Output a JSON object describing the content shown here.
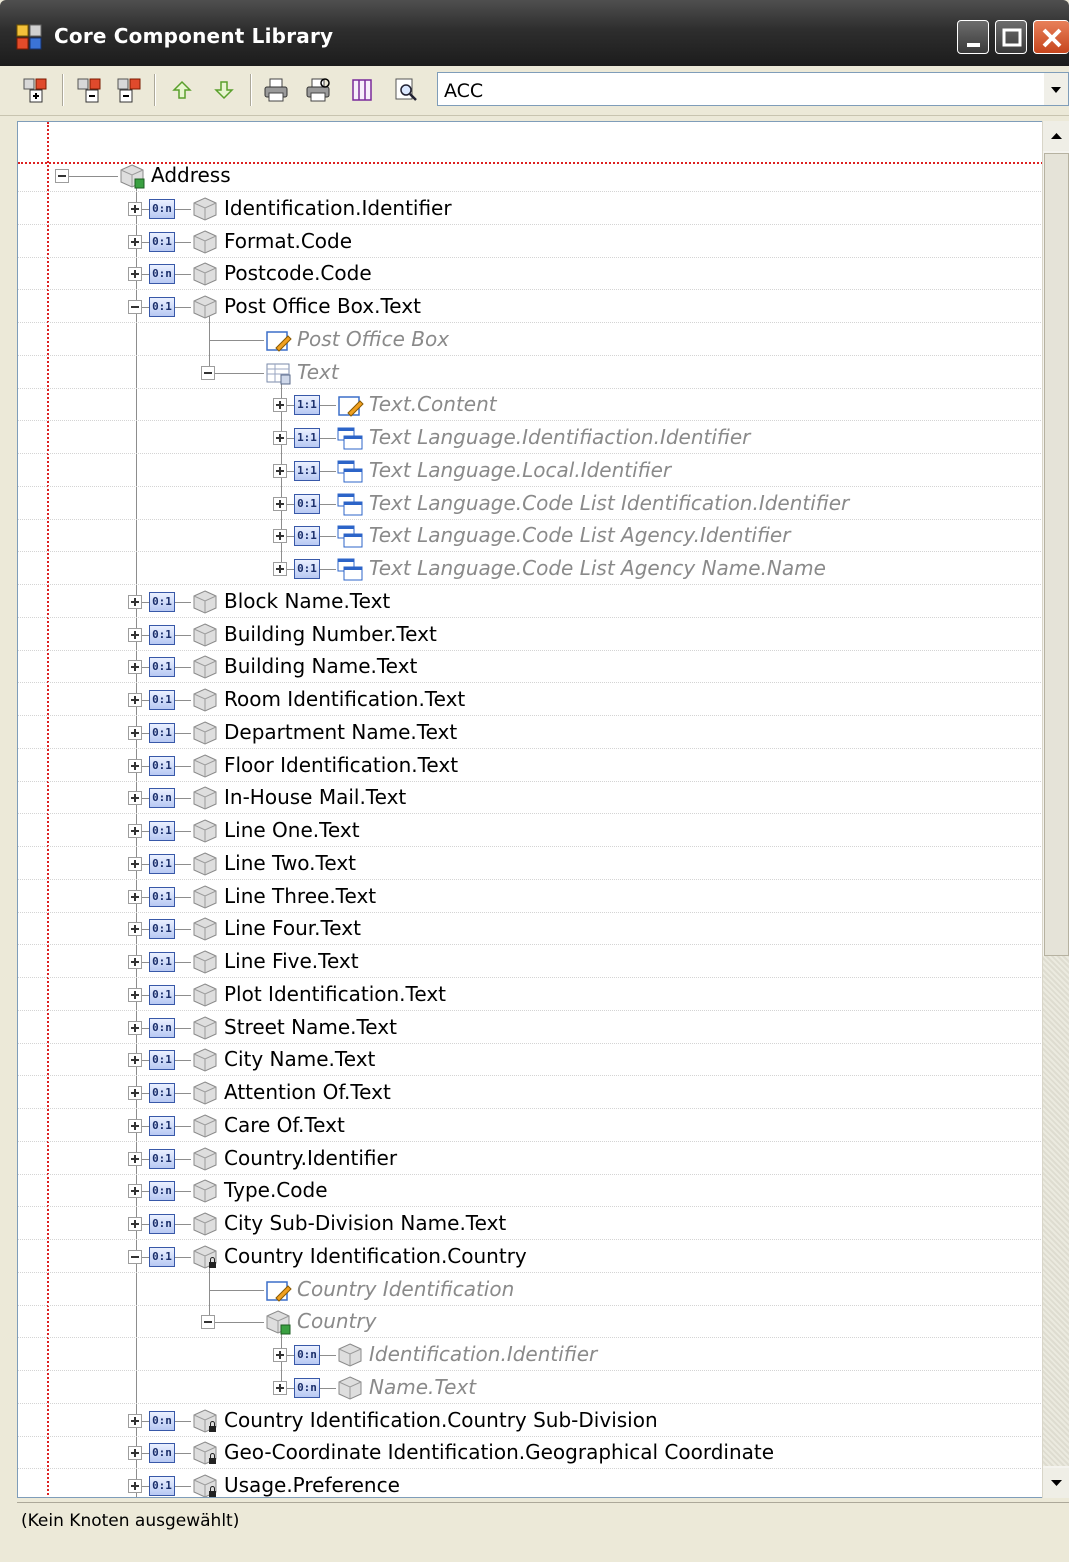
{
  "window": {
    "title": "Core Component Library"
  },
  "toolbar": {
    "combo_value": "ACC",
    "buttons": [
      "add-node-icon",
      "add-child-icon",
      "remove-node-icon",
      "move-up-icon",
      "move-down-icon",
      "print-icon",
      "print-preview-icon",
      "columns-icon",
      "zoom-icon"
    ]
  },
  "tree": {
    "root": "Address",
    "rows": [
      {
        "depth": 0,
        "label": "Address",
        "card": "",
        "kind": "root",
        "expanded": true,
        "italic": false
      },
      {
        "depth": 1,
        "label": "Identification.Identifier",
        "card": "0:n",
        "kind": "cube",
        "expanded": false,
        "italic": false
      },
      {
        "depth": 1,
        "label": "Format.Code",
        "card": "0:1",
        "kind": "cube",
        "expanded": false,
        "italic": false
      },
      {
        "depth": 1,
        "label": "Postcode.Code",
        "card": "0:n",
        "kind": "cube",
        "expanded": false,
        "italic": false
      },
      {
        "depth": 1,
        "label": "Post Office Box.Text",
        "card": "0:1",
        "kind": "cube",
        "expanded": true,
        "italic": false
      },
      {
        "depth": 2,
        "label": "Post Office Box",
        "card": "",
        "kind": "edit",
        "expanded": null,
        "italic": true
      },
      {
        "depth": 2,
        "label": "Text",
        "card": "",
        "kind": "table",
        "expanded": true,
        "italic": true
      },
      {
        "depth": 3,
        "label": "Text.Content",
        "card": "1:1",
        "kind": "edit",
        "expanded": false,
        "italic": true
      },
      {
        "depth": 3,
        "label": "Text  Language.Identifiaction.Identifier",
        "card": "1:1",
        "kind": "window",
        "expanded": false,
        "italic": true
      },
      {
        "depth": 3,
        "label": "Text Language.Local.Identifier",
        "card": "1:1",
        "kind": "window",
        "expanded": false,
        "italic": true
      },
      {
        "depth": 3,
        "label": "Text  Language.Code  List  Identification.Identifier",
        "card": "0:1",
        "kind": "window",
        "expanded": false,
        "italic": true
      },
      {
        "depth": 3,
        "label": "Text  Language.Code  List  Agency.Identifier",
        "card": "0:1",
        "kind": "window",
        "expanded": false,
        "italic": true
      },
      {
        "depth": 3,
        "label": "Text  Language.Code  List  Agency  Name.Name",
        "card": "0:1",
        "kind": "window",
        "expanded": false,
        "italic": true
      },
      {
        "depth": 1,
        "label": "Block Name.Text",
        "card": "0:1",
        "kind": "cube",
        "expanded": false,
        "italic": false
      },
      {
        "depth": 1,
        "label": "Building Number.Text",
        "card": "0:1",
        "kind": "cube",
        "expanded": false,
        "italic": false
      },
      {
        "depth": 1,
        "label": "Building Name.Text",
        "card": "0:1",
        "kind": "cube",
        "expanded": false,
        "italic": false
      },
      {
        "depth": 1,
        "label": "Room Identification.Text",
        "card": "0:1",
        "kind": "cube",
        "expanded": false,
        "italic": false
      },
      {
        "depth": 1,
        "label": "Department Name.Text",
        "card": "0:1",
        "kind": "cube",
        "expanded": false,
        "italic": false
      },
      {
        "depth": 1,
        "label": "Floor Identification.Text",
        "card": "0:1",
        "kind": "cube",
        "expanded": false,
        "italic": false
      },
      {
        "depth": 1,
        "label": "In-House Mail.Text",
        "card": "0:n",
        "kind": "cube",
        "expanded": false,
        "italic": false
      },
      {
        "depth": 1,
        "label": "Line One.Text",
        "card": "0:1",
        "kind": "cube",
        "expanded": false,
        "italic": false
      },
      {
        "depth": 1,
        "label": "Line Two.Text",
        "card": "0:1",
        "kind": "cube",
        "expanded": false,
        "italic": false
      },
      {
        "depth": 1,
        "label": "Line Three.Text",
        "card": "0:1",
        "kind": "cube",
        "expanded": false,
        "italic": false
      },
      {
        "depth": 1,
        "label": "Line Four.Text",
        "card": "0:1",
        "kind": "cube",
        "expanded": false,
        "italic": false
      },
      {
        "depth": 1,
        "label": "Line Five.Text",
        "card": "0:1",
        "kind": "cube",
        "expanded": false,
        "italic": false
      },
      {
        "depth": 1,
        "label": "Plot Identification.Text",
        "card": "0:1",
        "kind": "cube",
        "expanded": false,
        "italic": false
      },
      {
        "depth": 1,
        "label": "Street Name.Text",
        "card": "0:n",
        "kind": "cube",
        "expanded": false,
        "italic": false
      },
      {
        "depth": 1,
        "label": "City Name.Text",
        "card": "0:1",
        "kind": "cube",
        "expanded": false,
        "italic": false
      },
      {
        "depth": 1,
        "label": "Attention Of.Text",
        "card": "0:1",
        "kind": "cube",
        "expanded": false,
        "italic": false
      },
      {
        "depth": 1,
        "label": "Care Of.Text",
        "card": "0:1",
        "kind": "cube",
        "expanded": false,
        "italic": false
      },
      {
        "depth": 1,
        "label": "Country.Identifier",
        "card": "0:1",
        "kind": "cube",
        "expanded": false,
        "italic": false
      },
      {
        "depth": 1,
        "label": "Type.Code",
        "card": "0:n",
        "kind": "cube",
        "expanded": false,
        "italic": false
      },
      {
        "depth": 1,
        "label": "City Sub-Division Name.Text",
        "card": "0:n",
        "kind": "cube",
        "expanded": false,
        "italic": false
      },
      {
        "depth": 1,
        "label": "Country  Identification.Country",
        "card": "0:1",
        "kind": "cube-lock",
        "expanded": true,
        "italic": false
      },
      {
        "depth": 2,
        "label": "Country  Identification",
        "card": "",
        "kind": "edit",
        "expanded": null,
        "italic": true
      },
      {
        "depth": 2,
        "label": "Country",
        "card": "",
        "kind": "root",
        "expanded": true,
        "italic": true
      },
      {
        "depth": 3,
        "label": "Identification.Identifier",
        "card": "0:n",
        "kind": "cube",
        "expanded": false,
        "italic": true
      },
      {
        "depth": 3,
        "label": "Name.Text",
        "card": "0:n",
        "kind": "cube",
        "expanded": false,
        "italic": true
      },
      {
        "depth": 1,
        "label": "Country  Identification.Country  Sub-Division",
        "card": "0:n",
        "kind": "cube-lock",
        "expanded": false,
        "italic": false
      },
      {
        "depth": 1,
        "label": "Geo-Coordinate  Identification.Geographical  Coordinate",
        "card": "0:n",
        "kind": "cube-lock",
        "expanded": false,
        "italic": false
      },
      {
        "depth": 1,
        "label": "Usage.Preference",
        "card": "0:1",
        "kind": "cube-lock",
        "expanded": false,
        "italic": false
      }
    ]
  },
  "status": {
    "text": "(Kein Knoten ausgewählt)"
  }
}
